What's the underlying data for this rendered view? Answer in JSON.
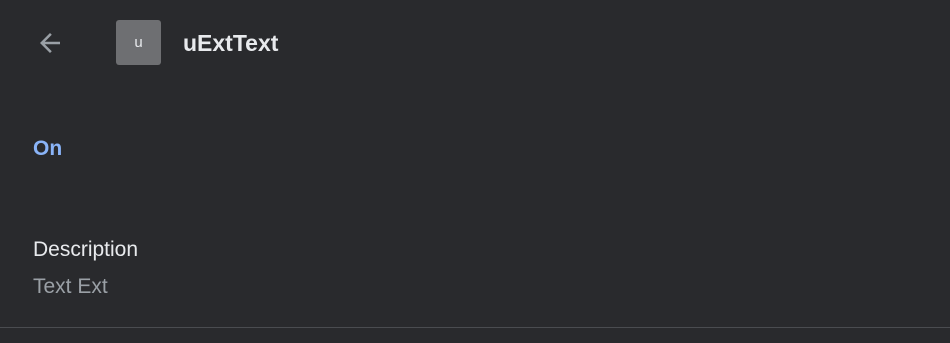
{
  "header": {
    "extension_icon_letter": "u",
    "title": "uExtText",
    "back_icon": "arrow-back-icon"
  },
  "status": {
    "label": "On",
    "color": "#8ab4f8"
  },
  "description": {
    "label": "Description",
    "value": "Text Ext"
  },
  "colors": {
    "background": "#292a2d",
    "primary_text": "#e8eaed",
    "secondary_text": "#9aa0a6"
  }
}
